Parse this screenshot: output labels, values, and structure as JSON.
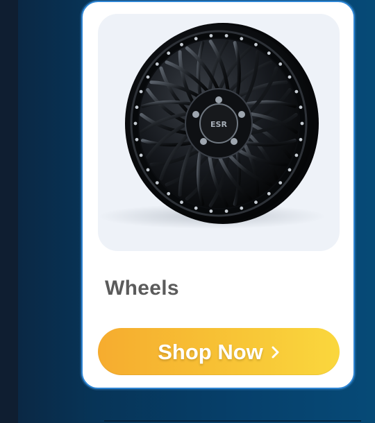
{
  "product": {
    "title": "Wheels",
    "image_alt": "Black multi-spoke wheel",
    "wheel_badge": "ESR"
  },
  "cta": {
    "label": "Shop Now",
    "icon": "chevron-right-icon"
  },
  "colors": {
    "page_bg_start": "#0b2540",
    "page_bg_end": "#064a77",
    "card_bg": "#ffffff",
    "card_border": "#2f86d4",
    "image_bg": "#eef2f8",
    "title": "#5b5b5b",
    "button_start": "#f6ac2f",
    "button_end": "#fad73d"
  }
}
